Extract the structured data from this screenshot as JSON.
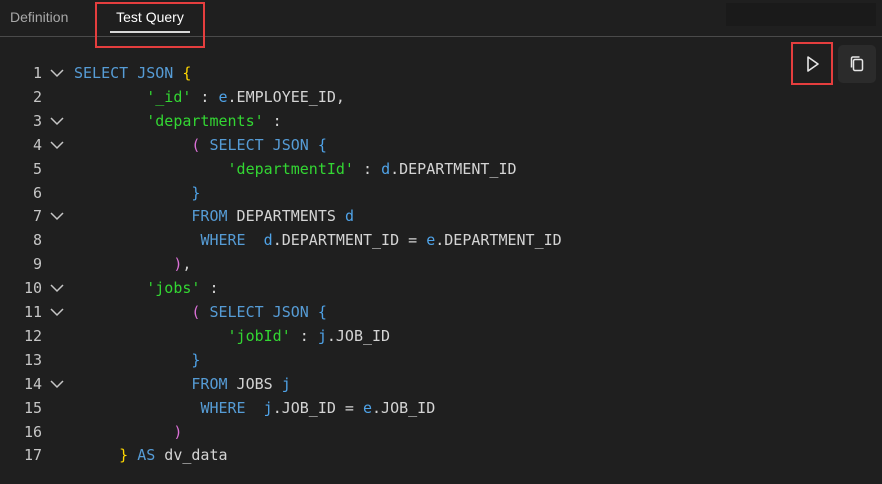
{
  "tabs": [
    {
      "label": "Definition",
      "active": false
    },
    {
      "label": "Test Query",
      "active": true
    }
  ],
  "toolbar": {
    "run_icon": "play-icon",
    "copy_icon": "copy-icon"
  },
  "colors": {
    "background": "#1f1f1f",
    "keyword": "#569cd6",
    "string": "#33d633",
    "highlight": "#e53e3e"
  },
  "editor": {
    "lines": [
      {
        "n": "1",
        "fold": true,
        "indent": "",
        "tokens": [
          [
            "kw",
            "SELECT JSON "
          ],
          [
            "brace1",
            "{"
          ]
        ]
      },
      {
        "n": "2",
        "fold": false,
        "indent": "        ",
        "tokens": [
          [
            "str",
            "'_id'"
          ],
          [
            "id",
            " : "
          ],
          [
            "alias",
            "e"
          ],
          [
            "id",
            ".EMPLOYEE_ID,"
          ]
        ]
      },
      {
        "n": "3",
        "fold": true,
        "indent": "        ",
        "tokens": [
          [
            "str",
            "'departments'"
          ],
          [
            "id",
            " :"
          ]
        ]
      },
      {
        "n": "4",
        "fold": true,
        "indent": "             ",
        "tokens": [
          [
            "brace2",
            "("
          ],
          [
            "id",
            " "
          ],
          [
            "kw",
            "SELECT JSON "
          ],
          [
            "brace3",
            "{"
          ]
        ]
      },
      {
        "n": "5",
        "fold": false,
        "indent": "                 ",
        "tokens": [
          [
            "str",
            "'departmentId'"
          ],
          [
            "id",
            " : "
          ],
          [
            "alias",
            "d"
          ],
          [
            "id",
            ".DEPARTMENT_ID"
          ]
        ]
      },
      {
        "n": "6",
        "fold": false,
        "indent": "             ",
        "tokens": [
          [
            "brace3",
            "}"
          ]
        ]
      },
      {
        "n": "7",
        "fold": true,
        "indent": "             ",
        "tokens": [
          [
            "kw",
            "FROM"
          ],
          [
            "id",
            " DEPARTMENTS "
          ],
          [
            "alias",
            "d"
          ]
        ]
      },
      {
        "n": "8",
        "fold": false,
        "indent": "              ",
        "tokens": [
          [
            "kw",
            "WHERE"
          ],
          [
            "id",
            "  "
          ],
          [
            "alias",
            "d"
          ],
          [
            "id",
            ".DEPARTMENT_ID = "
          ],
          [
            "alias",
            "e"
          ],
          [
            "id",
            ".DEPARTMENT_ID"
          ]
        ]
      },
      {
        "n": "9",
        "fold": false,
        "indent": "           ",
        "tokens": [
          [
            "brace2",
            ")"
          ],
          [
            "id",
            ","
          ]
        ]
      },
      {
        "n": "10",
        "fold": true,
        "indent": "        ",
        "tokens": [
          [
            "str",
            "'jobs'"
          ],
          [
            "id",
            " :"
          ]
        ]
      },
      {
        "n": "11",
        "fold": true,
        "indent": "             ",
        "tokens": [
          [
            "brace2",
            "("
          ],
          [
            "id",
            " "
          ],
          [
            "kw",
            "SELECT JSON "
          ],
          [
            "brace3",
            "{"
          ]
        ]
      },
      {
        "n": "12",
        "fold": false,
        "indent": "                 ",
        "tokens": [
          [
            "str",
            "'jobId'"
          ],
          [
            "id",
            " : "
          ],
          [
            "alias",
            "j"
          ],
          [
            "id",
            ".JOB_ID"
          ]
        ]
      },
      {
        "n": "13",
        "fold": false,
        "indent": "             ",
        "tokens": [
          [
            "brace3",
            "}"
          ]
        ]
      },
      {
        "n": "14",
        "fold": true,
        "indent": "             ",
        "tokens": [
          [
            "kw",
            "FROM"
          ],
          [
            "id",
            " JOBS "
          ],
          [
            "alias",
            "j"
          ]
        ]
      },
      {
        "n": "15",
        "fold": false,
        "indent": "              ",
        "tokens": [
          [
            "kw",
            "WHERE"
          ],
          [
            "id",
            "  "
          ],
          [
            "alias",
            "j"
          ],
          [
            "id",
            ".JOB_ID = "
          ],
          [
            "alias",
            "e"
          ],
          [
            "id",
            ".JOB_ID"
          ]
        ]
      },
      {
        "n": "16",
        "fold": false,
        "indent": "           ",
        "tokens": [
          [
            "brace2",
            ")"
          ]
        ]
      },
      {
        "n": "17",
        "fold": false,
        "indent": "     ",
        "tokens": [
          [
            "brace1",
            "}"
          ],
          [
            "id",
            " "
          ],
          [
            "kw",
            "AS"
          ],
          [
            "id",
            " dv_data"
          ]
        ]
      }
    ]
  }
}
